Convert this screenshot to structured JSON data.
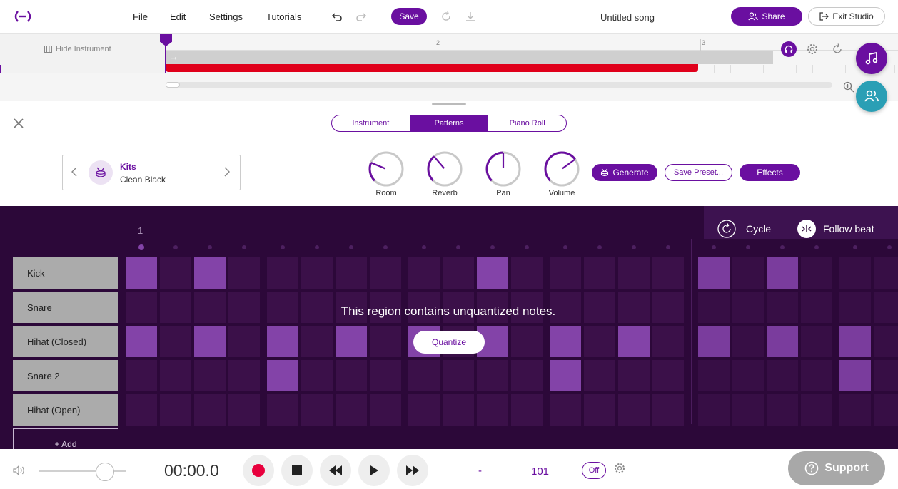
{
  "menu": {
    "file": "File",
    "edit": "Edit",
    "settings": "Settings",
    "tutorials": "Tutorials"
  },
  "toolbar": {
    "save_label": "Save",
    "song_title": "Untitled song",
    "share_label": "Share",
    "exit_label": "Exit Studio"
  },
  "timeline": {
    "hide_instrument": "Hide Instrument",
    "markers": [
      "2",
      "3"
    ]
  },
  "tabs": [
    {
      "label": "Instrument",
      "active": false
    },
    {
      "label": "Patterns",
      "active": true
    },
    {
      "label": "Piano Roll",
      "active": false
    }
  ],
  "kit": {
    "category": "Kits",
    "name": "Clean Black"
  },
  "knobs": [
    {
      "label": "Room",
      "value": 0.25
    },
    {
      "label": "Reverb",
      "value": 0.35
    },
    {
      "label": "Pan",
      "value": 0.5
    },
    {
      "label": "Volume",
      "value": 0.7
    }
  ],
  "actions": {
    "generate": "Generate",
    "save_preset": "Save Preset...",
    "effects": "Effects"
  },
  "grid": {
    "bar_number": "1",
    "cycle_label": "Cycle",
    "follow_label": "Follow beat",
    "overlay_message": "This region contains unquantized notes.",
    "quantize_label": "Quantize",
    "add_label": "+ Add",
    "rows": [
      {
        "name": "Kick",
        "steps": [
          1,
          0,
          1,
          0,
          0,
          0,
          0,
          0,
          0,
          0,
          1,
          0,
          0,
          0,
          0,
          0,
          1,
          0,
          1,
          0,
          0,
          0
        ]
      },
      {
        "name": "Snare",
        "steps": [
          0,
          0,
          0,
          0,
          0,
          0,
          0,
          0,
          0,
          0,
          0,
          0,
          0,
          0,
          0,
          0,
          0,
          0,
          0,
          0,
          0,
          0
        ]
      },
      {
        "name": "Hihat (Closed)",
        "steps": [
          1,
          0,
          1,
          0,
          1,
          0,
          1,
          0,
          1,
          0,
          1,
          0,
          1,
          0,
          1,
          0,
          1,
          0,
          1,
          0,
          1,
          0
        ]
      },
      {
        "name": "Snare 2",
        "steps": [
          0,
          0,
          0,
          0,
          1,
          0,
          0,
          0,
          0,
          0,
          0,
          0,
          1,
          0,
          0,
          0,
          0,
          0,
          0,
          0,
          1,
          0
        ]
      },
      {
        "name": "Hihat (Open)",
        "steps": [
          0,
          0,
          0,
          0,
          0,
          0,
          0,
          0,
          0,
          0,
          0,
          0,
          0,
          0,
          0,
          0,
          0,
          0,
          0,
          0,
          0,
          0
        ]
      }
    ]
  },
  "transport": {
    "time": "00:00.0",
    "key": "-",
    "tempo": "101",
    "metronome": "Off",
    "support": "Support"
  },
  "colors": {
    "accent": "#6a0fa0",
    "record": "#e8003d",
    "grid_bg": "#2c0839",
    "teal": "#2a9fb5"
  }
}
